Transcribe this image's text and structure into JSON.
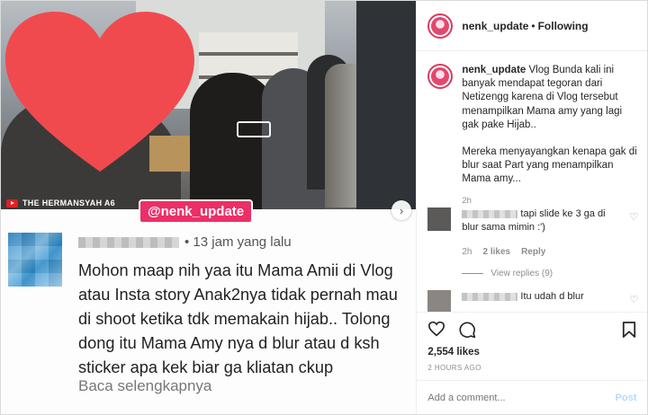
{
  "header": {
    "username": "nenk_update",
    "separator": "•",
    "follow_status": "Following"
  },
  "media": {
    "channel_credit": "THE HERMANSYAH A6",
    "watermark": "@nenk_update",
    "comment_card": {
      "time": "• 13 jam yang lalu",
      "body": "Mohon maap nih yaa itu Mama Amii di Vlog atau Insta story Anak2nya tidak pernah mau di shoot ketika tdk memakain hijab.. Tolong dong itu Mama Amy nya d blur atau d ksh sticker apa kek biar ga kliatan ckup",
      "read_more": "Baca selengkapnya"
    },
    "next_icon": "chevron-right-icon"
  },
  "caption": {
    "username": "nenk_update",
    "para1": "Vlog Bunda kali ini banyak mendapat tegoran dari Netizengg karena di Vlog tersebut menampilkan Mama amy yang lagi gak pake Hijab..",
    "para2": "Mereka menyayangkan kenapa gak di blur saat Part yang menampilkan Mama amy...",
    "age": "2h"
  },
  "comments": [
    {
      "text": "tapi slide ke 3 ga di blur sama mimin :')",
      "age": "2h",
      "likes": "2 likes",
      "reply": "Reply",
      "view_replies": "View replies (9)"
    },
    {
      "text": "Itu udah d blur"
    }
  ],
  "actions": {
    "likes": "2,554 likes",
    "timestamp": "2 HOURS AGO"
  },
  "add_comment": {
    "placeholder": "Add a comment...",
    "post_label": "Post"
  },
  "colors": {
    "accent_pink": "#ec2f67",
    "post_disabled": "#b3dbff",
    "secondary_text": "#8e8e8e"
  }
}
